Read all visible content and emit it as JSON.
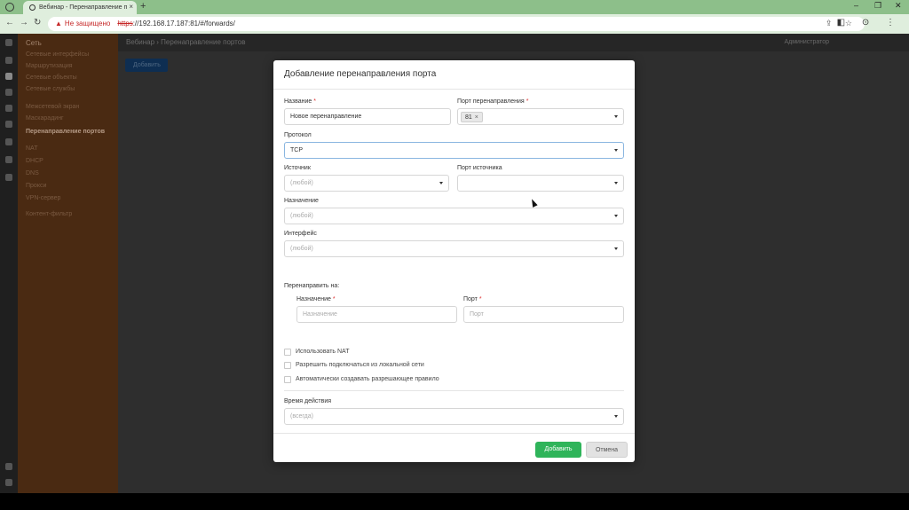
{
  "browser": {
    "tab_title": "Вебинар - Перенаправление п",
    "tab_close": "×",
    "new_tab": "+",
    "win_min": "–",
    "win_max": "❐",
    "win_close": "✕",
    "back": "←",
    "forward": "→",
    "reload": "↻",
    "warning_icon": "▲",
    "insecure_label": "Не защищено",
    "url_scheme": "https",
    "url_rest": "://192.168.17.187:81/#/forwards/",
    "omni_icons": "⇪ ☆",
    "actions": "◧ ⊙ ⋮"
  },
  "sidebar": {
    "header": "Сеть",
    "items": [
      "Сетевые интерфейсы",
      "Маршрутизация",
      "Сетевые объекты",
      "Сетевые службы",
      "Межсетевой экран",
      "Маскарадинг",
      "Перенаправление портов",
      "NAT",
      "DHCP",
      "DNS",
      "Прокси",
      "VPN-сервер",
      "Контент-фильтр"
    ],
    "active_index": 6
  },
  "background": {
    "breadcrumb": "Вебинар  ›  Перенаправление портов",
    "user": "Администратор",
    "add_button": "Добавить"
  },
  "modal": {
    "title": "Добавление перенаправления порта",
    "name": {
      "label": "Название",
      "required": "*",
      "value": "Новое перенаправление"
    },
    "redirect_port": {
      "label": "Порт перенаправления",
      "required": "*",
      "chip": "81",
      "chip_remove": "×"
    },
    "protocol": {
      "label": "Протокол",
      "value": "TCP"
    },
    "source": {
      "label": "Источник",
      "placeholder": "(любой)"
    },
    "source_port": {
      "label": "Порт источника",
      "value": ""
    },
    "destination": {
      "label": "Назначение",
      "placeholder": "(любой)"
    },
    "interface": {
      "label": "Интерфейс",
      "placeholder": "(любой)"
    },
    "redirect_to": {
      "label": "Перенаправить на:",
      "dest_label": "Назначение",
      "dest_required": "*",
      "dest_placeholder": "Назначение",
      "port_label": "Порт",
      "port_required": "*",
      "port_placeholder": "Порт"
    },
    "checkboxes": [
      {
        "label": "Использовать NAT",
        "checked": false
      },
      {
        "label": "Разрешить подключаться из локальной сети",
        "checked": false
      },
      {
        "label": "Автоматически создавать разрешающее правило",
        "checked": false
      }
    ],
    "schedule": {
      "label": "Время действия",
      "placeholder": "(всегда)"
    },
    "add_button": "Добавить",
    "cancel_button": "Отмена"
  },
  "colors": {
    "accent_green": "#2fb45a",
    "browser_tab_green": "#8dbf8a",
    "sidebar_brown": "#4a2a12"
  }
}
